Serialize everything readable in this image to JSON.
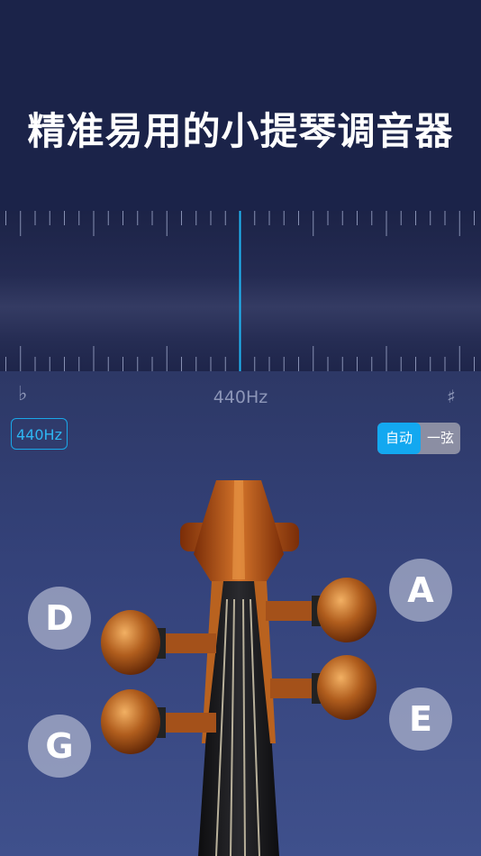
{
  "headline": "精准易用的小提琴调音器",
  "meter": {
    "flat_symbol": "♭",
    "sharp_symbol": "♯",
    "frequency": "440Hz"
  },
  "controls": {
    "pitch_reference": "440Hz",
    "mode_options": [
      "自动",
      "一弦"
    ],
    "selected_mode": "自动"
  },
  "strings": {
    "left_top": "D",
    "left_bottom": "G",
    "right_top": "A",
    "right_bottom": "E"
  },
  "colors": {
    "accent": "#13a8f0",
    "background": "#1b2349",
    "needle": "#1fb6f5"
  }
}
